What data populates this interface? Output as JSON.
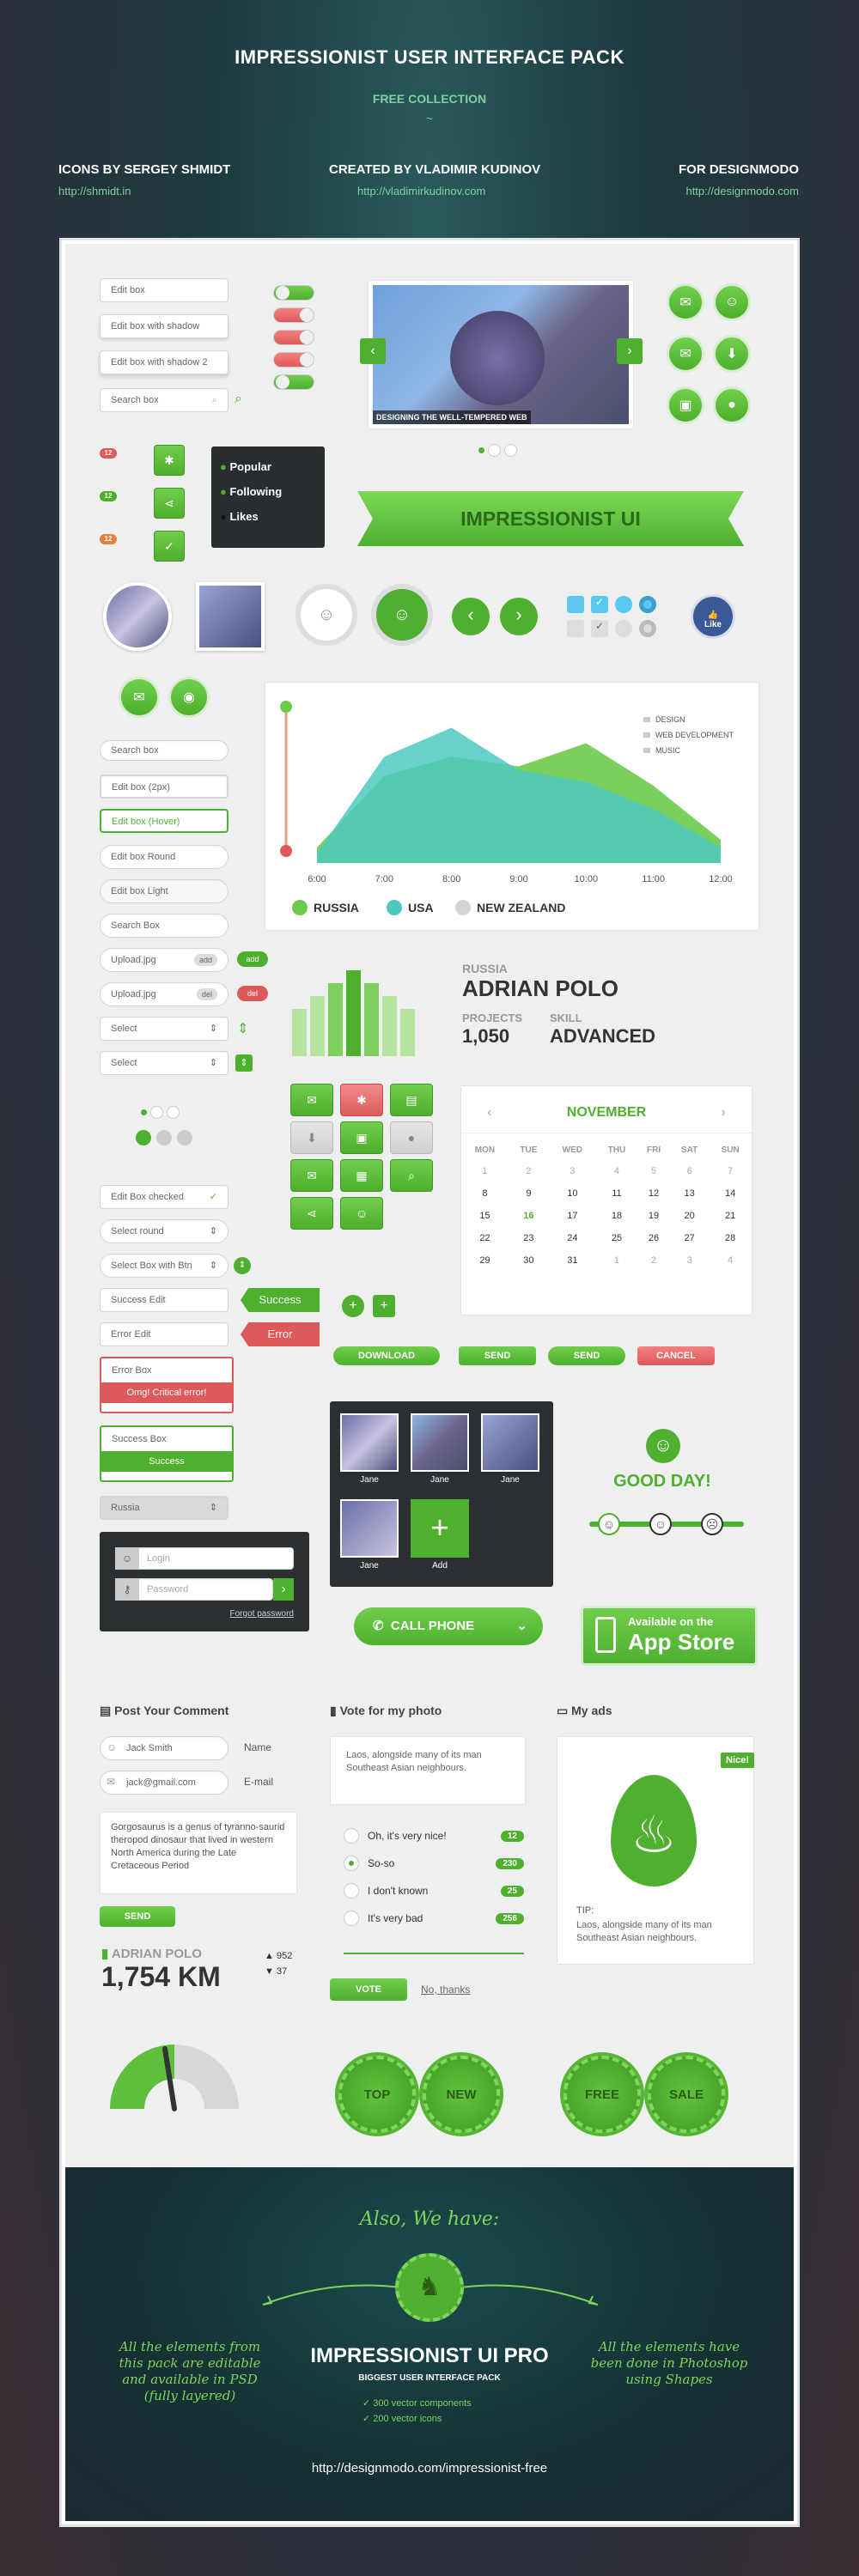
{
  "header": {
    "title": "IMPRESSIONIST USER INTERFACE PACK",
    "subtitle": "FREE COLLECTION",
    "credits": [
      {
        "label": "ICONS BY SERGEY SHMIDT",
        "url": "http://shmidt.in"
      },
      {
        "label": "CREATED BY VLADIMIR KUDINOV",
        "url": "http://vladimirkudinov.com"
      },
      {
        "label": "FOR DESIGNMODO",
        "url": "http://designmodo.com"
      }
    ]
  },
  "inputs": {
    "edit_box": "Edit box",
    "edit_shadow": "Edit box with shadow",
    "edit_shadow2": "Edit box with shadow 2",
    "search_box": "Search box"
  },
  "slider": {
    "caption": "DESIGNING THE WELL-TEMPERED WEB"
  },
  "badges": [
    "12",
    "12",
    "12"
  ],
  "dropdown": {
    "items": [
      "Popular",
      "Following",
      "Likes"
    ]
  },
  "ribbon": "IMPRESSIONIST UI",
  "like": "Like",
  "form_col": {
    "search1": "Search box",
    "edit2px": "Edit box (2px)",
    "hover": "Edit box (Hover)",
    "round": "Edit box Round",
    "light": "Edit box Light",
    "search2": "Search Box",
    "upload1": "Upload.jpg",
    "add": "add",
    "upload2": "Upload.jpg",
    "del": "del",
    "select1": "Select",
    "select2": "Select"
  },
  "chart_data": {
    "type": "area",
    "x": [
      "6:00",
      "7:00",
      "8:00",
      "9:00",
      "10:00",
      "11:00",
      "12:00"
    ],
    "series": [
      {
        "name": "RUSSIA",
        "values": [
          8,
          45,
          55,
          50,
          62,
          40,
          12
        ]
      },
      {
        "name": "USA",
        "values": [
          5,
          55,
          70,
          48,
          42,
          28,
          8
        ]
      },
      {
        "name": "NEW ZEALAND",
        "values": [
          4,
          25,
          35,
          38,
          30,
          25,
          6
        ]
      }
    ],
    "legend_top": [
      "DESIGN",
      "WEB DEVELOPMENT",
      "MUSIC"
    ],
    "colors": {
      "RUSSIA": "#6dcb4b",
      "USA": "#4dc9c0",
      "NEW ZEALAND": "#cfd6d4"
    }
  },
  "profile": {
    "country": "RUSSIA",
    "name": "ADRIAN POLO",
    "projects_label": "PROJECTS",
    "projects": "1,050",
    "skill_label": "SKILL",
    "skill": "ADVANCED"
  },
  "bars": {
    "values": [
      0.55,
      0.7,
      0.85,
      1.0,
      0.85,
      0.7,
      0.55
    ]
  },
  "calendar": {
    "month": "NOVEMBER",
    "days": [
      "MON",
      "TUE",
      "WED",
      "THU",
      "FRI",
      "SAT",
      "SUN"
    ],
    "weeks": [
      [
        "1",
        "2",
        "3",
        "4",
        "5",
        "6",
        "7"
      ],
      [
        "8",
        "9",
        "10",
        "11",
        "12",
        "13",
        "14"
      ],
      [
        "15",
        "16",
        "17",
        "18",
        "19",
        "20",
        "21"
      ],
      [
        "22",
        "23",
        "24",
        "25",
        "26",
        "27",
        "28"
      ],
      [
        "29",
        "30",
        "31",
        "1",
        "2",
        "3",
        "4"
      ]
    ],
    "today": "16"
  },
  "form_col2": {
    "checked": "Edit Box checked",
    "select_round": "Select round",
    "select_btn": "Select Box with Btn",
    "success": "Success Edit",
    "success_tag": "Success",
    "error": "Error Edit",
    "error_tag": "Error",
    "error_box": "Error Box",
    "error_msg": "Omg! Critical error!",
    "success_box": "Success Box",
    "success_msg": "Success",
    "country": "Russia"
  },
  "buttons": {
    "download": "DOWNLOAD",
    "send1": "SEND",
    "send2": "SEND",
    "cancel": "CANCEL"
  },
  "gallery": {
    "names": [
      "Jane",
      "Jane",
      "Jane",
      "Jane"
    ],
    "add": "Add"
  },
  "mood": {
    "text": "GOOD DAY!"
  },
  "login": {
    "login": "Login",
    "password": "Password",
    "forgot": "Forgot password"
  },
  "call": {
    "label": "CALL PHONE"
  },
  "appstore": {
    "small": "Available on the",
    "big": "App Store"
  },
  "comment": {
    "title": "Post Your Comment",
    "name": "Jack Smith",
    "name_label": "Name",
    "email": "jack@gmail.com",
    "email_label": "E-mail",
    "text": "Gorgosaurus is a genus of tyranno-saurid theropod dinosaur that lived in western North America during the Late Cretaceous Period",
    "send": "SEND"
  },
  "vote": {
    "title": "Vote for my photo",
    "text": "Laos, alongside many of its man Southeast Asian neighbours.",
    "options": [
      {
        "label": "Oh, it's very nice!",
        "count": "12"
      },
      {
        "label": "So-so",
        "count": "230"
      },
      {
        "label": "I don't known",
        "count": "25"
      },
      {
        "label": "It's very bad",
        "count": "256"
      }
    ],
    "vote": "VOTE",
    "nothanks": "No, thanks"
  },
  "ads": {
    "title": "My ads",
    "nice": "Nice!",
    "tip": "TIP:",
    "text": "Laos, alongside many of its man Southeast Asian neighbours."
  },
  "stats": {
    "name": "ADRIAN POLO",
    "km": "1,754 KM",
    "likes": "952",
    "dislikes": "37"
  },
  "seals": [
    "TOP",
    "NEW",
    "FREE",
    "SALE"
  ],
  "promo": {
    "also": "Also, We have:",
    "left": "All the elements from this pack are editable and available in PSD (fully layered)",
    "right": "All the elements have been done in Photoshop using Shapes",
    "title": "IMPRESSIONIST UI PRO",
    "sub": "BIGGEST USER INTERFACE PACK",
    "f1": "300 vector components",
    "f2": "200 vector icons",
    "url": "http://designmodo.com/impressionist-free"
  }
}
